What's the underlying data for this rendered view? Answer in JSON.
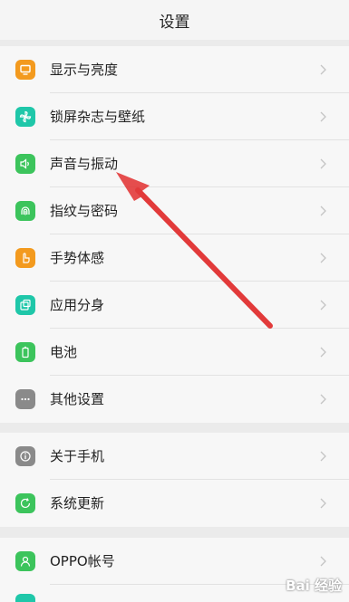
{
  "header": {
    "title": "设置"
  },
  "group1": [
    {
      "label": "显示与亮度",
      "icon": "display-icon",
      "color": "#f39a1e"
    },
    {
      "label": "锁屏杂志与壁纸",
      "icon": "pinwheel-icon",
      "color": "#1fc7a9"
    },
    {
      "label": "声音与振动",
      "icon": "speaker-icon",
      "color": "#3cc45c"
    },
    {
      "label": "指纹与密码",
      "icon": "fingerprint-icon",
      "color": "#3cc45c"
    },
    {
      "label": "手势体感",
      "icon": "hand-icon",
      "color": "#f39a1e"
    },
    {
      "label": "应用分身",
      "icon": "clone-icon",
      "color": "#1fc7a9"
    },
    {
      "label": "电池",
      "icon": "battery-icon",
      "color": "#3cc45c"
    },
    {
      "label": "其他设置",
      "icon": "more-icon",
      "color": "#8a8a8a"
    }
  ],
  "group2": [
    {
      "label": "关于手机",
      "icon": "info-icon",
      "color": "#8a8a8a"
    },
    {
      "label": "系统更新",
      "icon": "update-icon",
      "color": "#3cc45c"
    }
  ],
  "group3": [
    {
      "label": "OPPO帐号",
      "icon": "account-icon",
      "color": "#3cc45c"
    }
  ],
  "watermark": {
    "text": "Bai 经验"
  },
  "annotation": {
    "color": "#e23a3a"
  }
}
